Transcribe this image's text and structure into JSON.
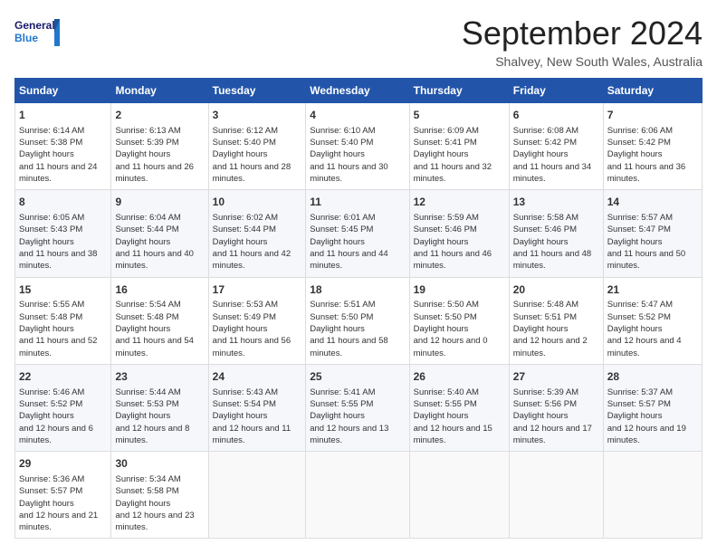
{
  "logo": {
    "general": "General",
    "blue": "Blue"
  },
  "title": "September 2024",
  "subtitle": "Shalvey, New South Wales, Australia",
  "days_of_week": [
    "Sunday",
    "Monday",
    "Tuesday",
    "Wednesday",
    "Thursday",
    "Friday",
    "Saturday"
  ],
  "weeks": [
    [
      {
        "day": "1",
        "sunrise": "6:14 AM",
        "sunset": "5:38 PM",
        "daylight": "11 hours and 24 minutes."
      },
      {
        "day": "2",
        "sunrise": "6:13 AM",
        "sunset": "5:39 PM",
        "daylight": "11 hours and 26 minutes."
      },
      {
        "day": "3",
        "sunrise": "6:12 AM",
        "sunset": "5:40 PM",
        "daylight": "11 hours and 28 minutes."
      },
      {
        "day": "4",
        "sunrise": "6:10 AM",
        "sunset": "5:40 PM",
        "daylight": "11 hours and 30 minutes."
      },
      {
        "day": "5",
        "sunrise": "6:09 AM",
        "sunset": "5:41 PM",
        "daylight": "11 hours and 32 minutes."
      },
      {
        "day": "6",
        "sunrise": "6:08 AM",
        "sunset": "5:42 PM",
        "daylight": "11 hours and 34 minutes."
      },
      {
        "day": "7",
        "sunrise": "6:06 AM",
        "sunset": "5:42 PM",
        "daylight": "11 hours and 36 minutes."
      }
    ],
    [
      {
        "day": "8",
        "sunrise": "6:05 AM",
        "sunset": "5:43 PM",
        "daylight": "11 hours and 38 minutes."
      },
      {
        "day": "9",
        "sunrise": "6:04 AM",
        "sunset": "5:44 PM",
        "daylight": "11 hours and 40 minutes."
      },
      {
        "day": "10",
        "sunrise": "6:02 AM",
        "sunset": "5:44 PM",
        "daylight": "11 hours and 42 minutes."
      },
      {
        "day": "11",
        "sunrise": "6:01 AM",
        "sunset": "5:45 PM",
        "daylight": "11 hours and 44 minutes."
      },
      {
        "day": "12",
        "sunrise": "5:59 AM",
        "sunset": "5:46 PM",
        "daylight": "11 hours and 46 minutes."
      },
      {
        "day": "13",
        "sunrise": "5:58 AM",
        "sunset": "5:46 PM",
        "daylight": "11 hours and 48 minutes."
      },
      {
        "day": "14",
        "sunrise": "5:57 AM",
        "sunset": "5:47 PM",
        "daylight": "11 hours and 50 minutes."
      }
    ],
    [
      {
        "day": "15",
        "sunrise": "5:55 AM",
        "sunset": "5:48 PM",
        "daylight": "11 hours and 52 minutes."
      },
      {
        "day": "16",
        "sunrise": "5:54 AM",
        "sunset": "5:48 PM",
        "daylight": "11 hours and 54 minutes."
      },
      {
        "day": "17",
        "sunrise": "5:53 AM",
        "sunset": "5:49 PM",
        "daylight": "11 hours and 56 minutes."
      },
      {
        "day": "18",
        "sunrise": "5:51 AM",
        "sunset": "5:50 PM",
        "daylight": "11 hours and 58 minutes."
      },
      {
        "day": "19",
        "sunrise": "5:50 AM",
        "sunset": "5:50 PM",
        "daylight": "12 hours and 0 minutes."
      },
      {
        "day": "20",
        "sunrise": "5:48 AM",
        "sunset": "5:51 PM",
        "daylight": "12 hours and 2 minutes."
      },
      {
        "day": "21",
        "sunrise": "5:47 AM",
        "sunset": "5:52 PM",
        "daylight": "12 hours and 4 minutes."
      }
    ],
    [
      {
        "day": "22",
        "sunrise": "5:46 AM",
        "sunset": "5:52 PM",
        "daylight": "12 hours and 6 minutes."
      },
      {
        "day": "23",
        "sunrise": "5:44 AM",
        "sunset": "5:53 PM",
        "daylight": "12 hours and 8 minutes."
      },
      {
        "day": "24",
        "sunrise": "5:43 AM",
        "sunset": "5:54 PM",
        "daylight": "12 hours and 11 minutes."
      },
      {
        "day": "25",
        "sunrise": "5:41 AM",
        "sunset": "5:55 PM",
        "daylight": "12 hours and 13 minutes."
      },
      {
        "day": "26",
        "sunrise": "5:40 AM",
        "sunset": "5:55 PM",
        "daylight": "12 hours and 15 minutes."
      },
      {
        "day": "27",
        "sunrise": "5:39 AM",
        "sunset": "5:56 PM",
        "daylight": "12 hours and 17 minutes."
      },
      {
        "day": "28",
        "sunrise": "5:37 AM",
        "sunset": "5:57 PM",
        "daylight": "12 hours and 19 minutes."
      }
    ],
    [
      {
        "day": "29",
        "sunrise": "5:36 AM",
        "sunset": "5:57 PM",
        "daylight": "12 hours and 21 minutes."
      },
      {
        "day": "30",
        "sunrise": "5:34 AM",
        "sunset": "5:58 PM",
        "daylight": "12 hours and 23 minutes."
      },
      null,
      null,
      null,
      null,
      null
    ]
  ]
}
